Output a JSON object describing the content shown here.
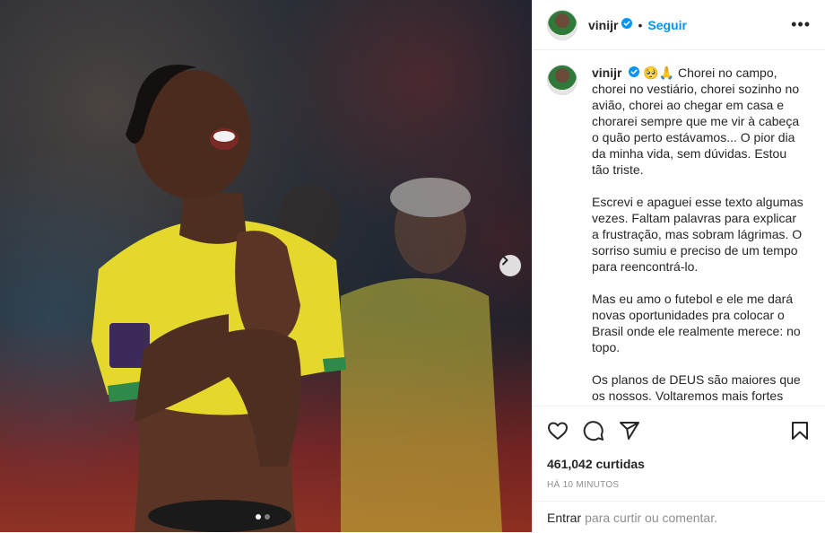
{
  "post": {
    "username": "vinijr",
    "follow_label": "Seguir",
    "separator": "•",
    "more_label": "•••",
    "caption_emojis": "🥺🙏",
    "caption_paragraphs": [
      "Chorei no campo, chorei no vestiário, chorei sozinho no avião, chorei ao chegar em casa e chorarei sempre que me vir à cabeça o quão perto estávamos... O pior dia da minha vida, sem dúvidas. Estou tão triste.",
      "Escrevi e apaguei esse texto algumas vezes. Faltam palavras para explicar a frustração, mas sobram lágrimas. O sorriso sumiu e preciso de um tempo para reencontrá-lo.",
      "Mas eu amo o futebol e ele me dará novas oportunidades pra colocar o Brasil onde ele realmente merece: no topo.",
      "Os planos de DEUS são maiores que os nossos. Voltaremos mais fortes que"
    ],
    "likes_text": "461,042 curtidas",
    "time_text": "HÁ 10 MINUTOS",
    "login_link": "Entrar",
    "comment_prompt": "para curtir ou comentar.",
    "carousel": {
      "total": 2,
      "active": 1
    },
    "icons": [
      "verified-icon",
      "heart-icon",
      "comment-icon",
      "share-icon",
      "save-icon",
      "chevron-right-icon"
    ],
    "colors": {
      "accent": "#0095f6",
      "muted": "#8e8e8e",
      "jersey": "#e3d82b"
    }
  }
}
